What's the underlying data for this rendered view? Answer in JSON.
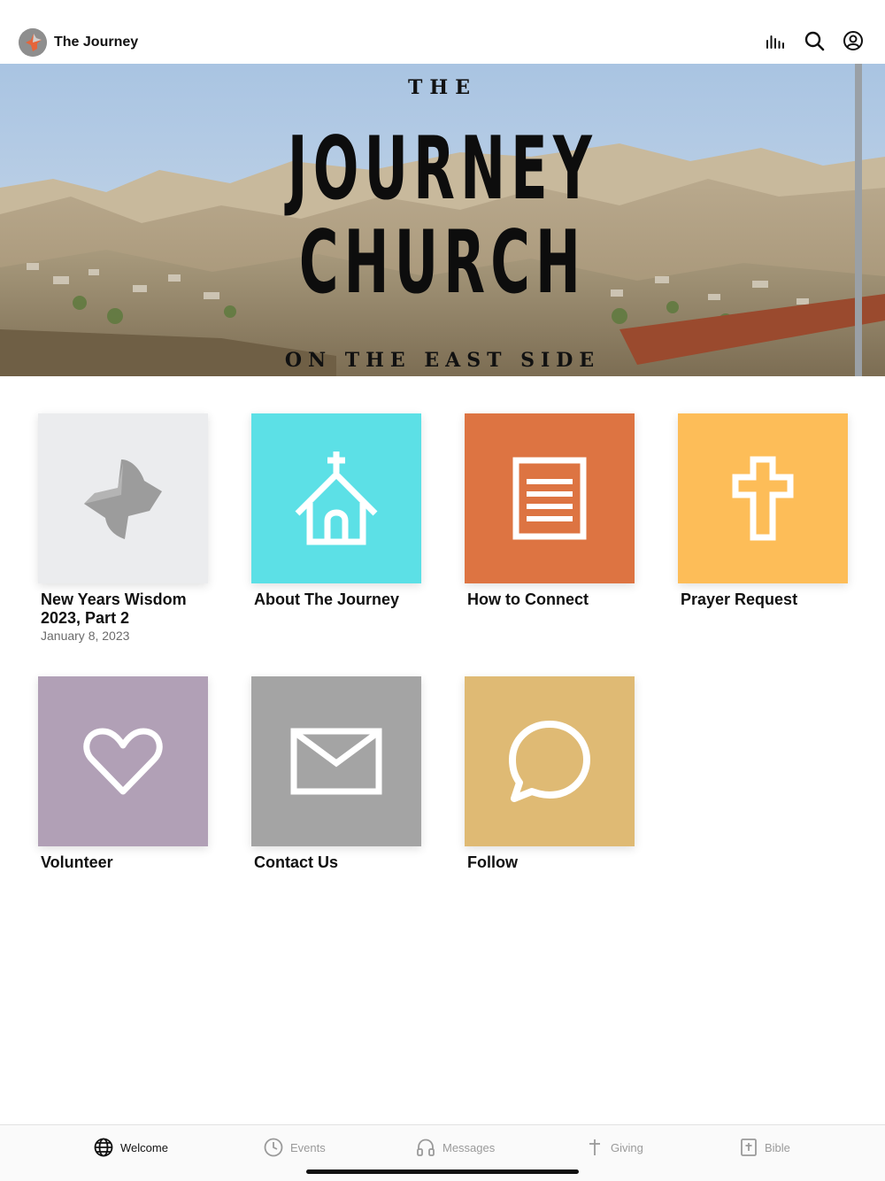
{
  "header": {
    "app_title": "The Journey",
    "logo_icon": "journey-logo-icon",
    "actions": [
      {
        "name": "audio-bars-icon"
      },
      {
        "name": "search-icon"
      },
      {
        "name": "account-icon"
      }
    ]
  },
  "hero": {
    "line_the": "THE",
    "line_journey": "JOURNEY",
    "line_church": "CHURCH",
    "line_sub": "ON THE EAST SIDE"
  },
  "tiles": [
    {
      "label": "New Years Wisdom 2023, Part 2",
      "date": "January 8, 2023",
      "color": "#ebecee",
      "icon": "journey-logo-icon"
    },
    {
      "label": "About The Journey",
      "color": "#5ce0e6",
      "icon": "church-icon"
    },
    {
      "label": "How to Connect",
      "color": "#dd7442",
      "icon": "document-icon"
    },
    {
      "label": "Prayer Request",
      "color": "#fdbd58",
      "icon": "cross-icon"
    },
    {
      "label": "Volunteer",
      "color": "#b1a0b6",
      "icon": "heart-icon"
    },
    {
      "label": "Contact Us",
      "color": "#a4a4a4",
      "icon": "envelope-icon"
    },
    {
      "label": "Follow",
      "color": "#dfba74",
      "icon": "chat-bubble-icon"
    }
  ],
  "tabbar": {
    "items": [
      {
        "label": "Welcome",
        "icon": "globe-icon",
        "active": true
      },
      {
        "label": "Events",
        "icon": "clock-icon",
        "active": false
      },
      {
        "label": "Messages",
        "icon": "headphones-icon",
        "active": false
      },
      {
        "label": "Giving",
        "icon": "cross-icon",
        "active": false
      },
      {
        "label": "Bible",
        "icon": "bible-icon",
        "active": false
      }
    ]
  }
}
